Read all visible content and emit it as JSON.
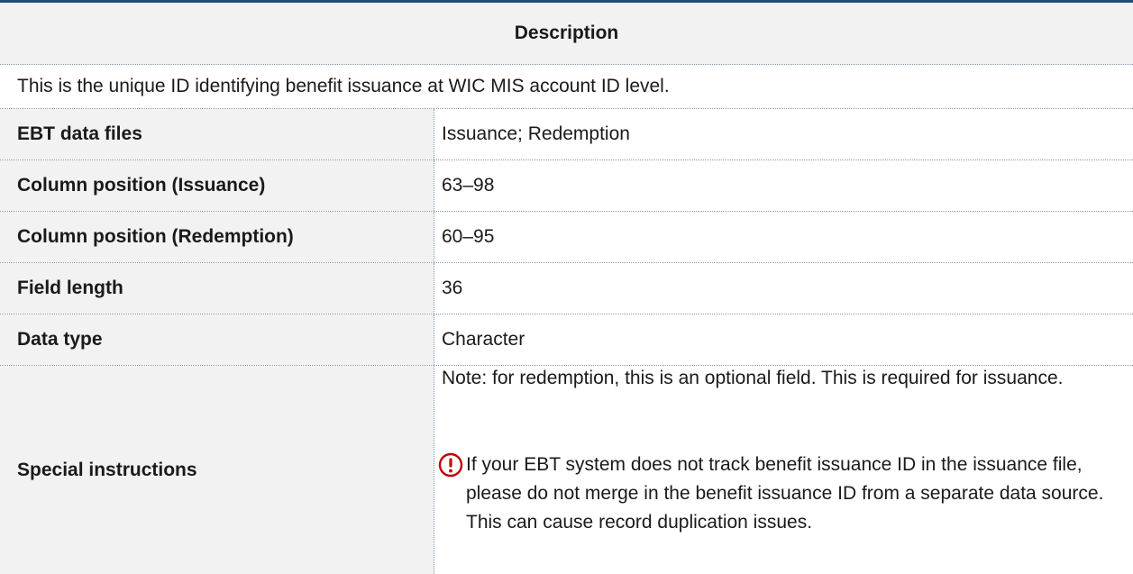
{
  "header": {
    "title": "Description"
  },
  "description": "This is the unique ID identifying benefit issuance at WIC MIS account ID level.",
  "rows": [
    {
      "label": "EBT data files",
      "value": "Issuance; Redemption"
    },
    {
      "label": "Column position (Issuance)",
      "value": "63–98"
    },
    {
      "label": "Column position (Redemption)",
      "value": "60–95"
    },
    {
      "label": "Field length",
      "value": "36"
    },
    {
      "label": "Data type",
      "value": "Character"
    }
  ],
  "special": {
    "label": "Special instructions",
    "note": "Note: for redemption, this is an optional field. This is required for issuance.",
    "warning_icon": "exclamation-circle-icon",
    "warning": "If your EBT system does not track benefit issuance ID in the issuance file, please do not merge in the benefit issuance ID from a separate data source. This can cause record duplication issues."
  },
  "colors": {
    "accent": "#1f4e79",
    "label_bg": "#f2f2f2",
    "warning": "#c00000"
  }
}
